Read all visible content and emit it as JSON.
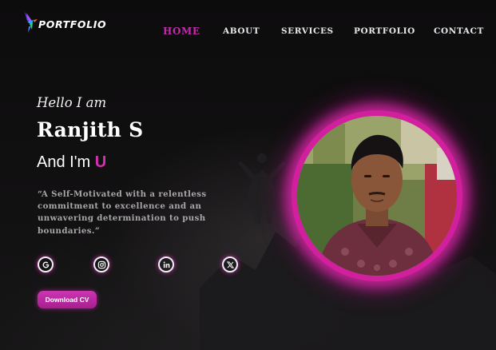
{
  "brand": {
    "name": "PORTFOLIO",
    "logo_icon": "bird-logo-icon"
  },
  "nav": {
    "items": [
      "HOME",
      "ABOUT",
      "SERVICES",
      "PORTFOLIO",
      "CONTACT"
    ],
    "active": "HOME"
  },
  "hero": {
    "greeting": "Hello I am",
    "name": "Ranjith S",
    "role_prefix": "And I'm ",
    "role_highlight": "U",
    "quote": "“A Self-Motivated with a relentless commitment to excellence and an unwavering determination to push boundaries.”"
  },
  "social": [
    {
      "name": "google",
      "icon": "google-icon"
    },
    {
      "name": "instagram",
      "icon": "instagram-icon"
    },
    {
      "name": "linkedin",
      "icon": "linkedin-icon"
    },
    {
      "name": "x",
      "icon": "x-twitter-icon"
    }
  ],
  "cta": {
    "download_label": "Download CV"
  },
  "colors": {
    "accent": "#c22aa9",
    "background": "#0c0b0c",
    "ring": "#d21f9e"
  }
}
